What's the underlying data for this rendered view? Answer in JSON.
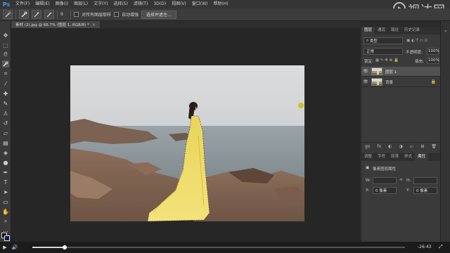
{
  "app": {
    "logo": "Ps",
    "watermark": "视达网"
  },
  "menu": [
    "文件(F)",
    "编辑(E)",
    "图像(I)",
    "图层(L)",
    "文字(Y)",
    "选择(S)",
    "滤镜(T)",
    "3D(D)",
    "视图(V)",
    "窗口(W)",
    "帮助(H)"
  ],
  "options": {
    "brush_size": "9",
    "sample_all_layers": "对所有图层取样",
    "auto_enhance": "自动增强",
    "refine_edge": "选择并遮住..."
  },
  "document_tab": {
    "title": "素材 (2).jpg @ 66.7% (图层 1, RGB/8) *",
    "close": "×"
  },
  "layers_panel": {
    "tabs": [
      "图层",
      "通道",
      "路径",
      "历史记录"
    ],
    "kind_filter": "类型",
    "blend_mode": "正常",
    "opacity_label": "不透明度:",
    "opacity_value": "100%",
    "lock_label": "锁定:",
    "fill_label": "填充:",
    "fill_value": "100%",
    "layers": [
      {
        "name": "图层 1",
        "selected": true
      },
      {
        "name": "背景",
        "selected": false,
        "locked": true
      }
    ],
    "bottom_icons": [
      "go",
      "fx",
      "◐",
      "◑",
      "▭",
      "⊞",
      "🗑"
    ]
  },
  "properties_panel": {
    "tabs": [
      "调整",
      "字符",
      "段落",
      "样式",
      "属性"
    ],
    "header": "像素图层属性",
    "w_label": "W:",
    "h_label": "H:",
    "x_label": "X:",
    "y_label": "Y:",
    "x_value": "0 像素",
    "y_value": "0 像素",
    "link": "∞"
  },
  "video": {
    "time": "-26:43",
    "progress": 0.087
  },
  "colors": {
    "foreground": "#000000",
    "background": "#0b1660",
    "accent": "#3aa0f5"
  }
}
